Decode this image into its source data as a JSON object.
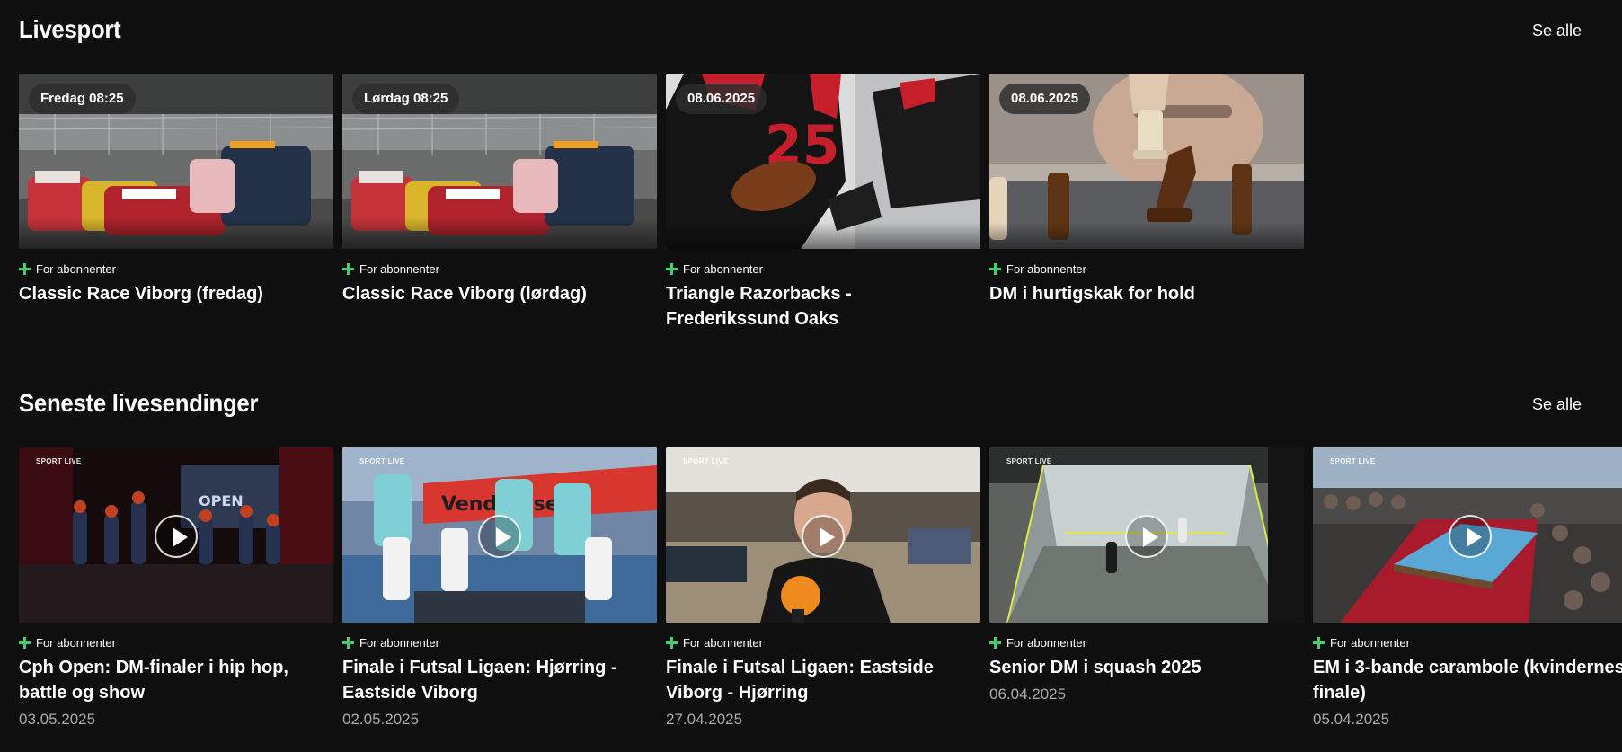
{
  "sections": {
    "live": {
      "title": "Livesport",
      "see_all": "Se alle",
      "cards": [
        {
          "badge": "Fredag 08:25",
          "subscriber": "For abonnenter",
          "title": "Classic Race Viborg (fredag)"
        },
        {
          "badge": "Lørdag 08:25",
          "subscriber": "For abonnenter",
          "title": "Classic Race Viborg (lørdag)"
        },
        {
          "badge": "08.06.2025",
          "subscriber": "For abonnenter",
          "title": "Triangle Razorbacks - Frederikssund Oaks"
        },
        {
          "badge": "08.06.2025",
          "subscriber": "For abonnenter",
          "title": "DM i hurtigskak for hold"
        }
      ]
    },
    "recent": {
      "title": "Seneste livesendinger",
      "see_all": "Se alle",
      "watermark": "SPORT LIVE",
      "cards": [
        {
          "subscriber": "For abonnenter",
          "title": "Cph Open: DM-finaler i hip hop, battle og show",
          "date": "03.05.2025"
        },
        {
          "subscriber": "For abonnenter",
          "title": "Finale i Futsal Ligaen: Hjørring - Eastside Viborg",
          "date": "02.05.2025"
        },
        {
          "subscriber": "For abonnenter",
          "title": "Finale i Futsal Ligaen: Eastside Viborg - Hjørring",
          "date": "27.04.2025"
        },
        {
          "subscriber": "For abonnenter",
          "title": "Senior DM i squash 2025",
          "date": "06.04.2025"
        },
        {
          "subscriber": "For abonnenter",
          "title": "EM i 3-bande carambole (kvindernes finale)",
          "date": "05.04.2025"
        }
      ]
    }
  },
  "colors": {
    "background": "#0f0f0f",
    "subscriber_plus": "#3bd36b",
    "date_text": "#a9a9a9"
  }
}
